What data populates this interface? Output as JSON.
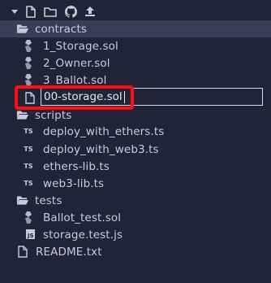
{
  "toolbar": {
    "icons": [
      "chevron-down-icon",
      "new-file-icon",
      "new-folder-icon",
      "github-icon",
      "upload-icon"
    ]
  },
  "tree": {
    "contracts": {
      "label": "contracts",
      "icon": "folder-open-icon"
    },
    "files_contracts": [
      {
        "label": "1_Storage.sol",
        "icon": "solidity-icon"
      },
      {
        "label": "2_Owner.sol",
        "icon": "solidity-icon"
      },
      {
        "label": "3_Ballot.sol",
        "icon": "solidity-icon"
      }
    ],
    "rename": {
      "value": "00-storage.sol",
      "icon": "file-icon"
    },
    "scripts": {
      "label": "scripts",
      "icon": "folder-open-icon"
    },
    "files_scripts": [
      {
        "label": "deploy_with_ethers.ts",
        "icon_text": "TS"
      },
      {
        "label": "deploy_with_web3.ts",
        "icon_text": "TS"
      },
      {
        "label": "ethers-lib.ts",
        "icon_text": "TS"
      },
      {
        "label": "web3-lib.ts",
        "icon_text": "TS"
      }
    ],
    "tests": {
      "label": "tests",
      "icon": "folder-open-icon"
    },
    "files_tests": [
      {
        "label": "Ballot_test.sol",
        "icon": "solidity-icon"
      },
      {
        "label": "storage.test.js",
        "icon_text": "JS"
      }
    ],
    "readme": {
      "label": "README.txt",
      "icon": "file-icon"
    }
  },
  "colors": {
    "background": "#222336",
    "selected_row": "#3a3d55",
    "text": "#c9cbdc",
    "highlight": "#ff1010"
  }
}
